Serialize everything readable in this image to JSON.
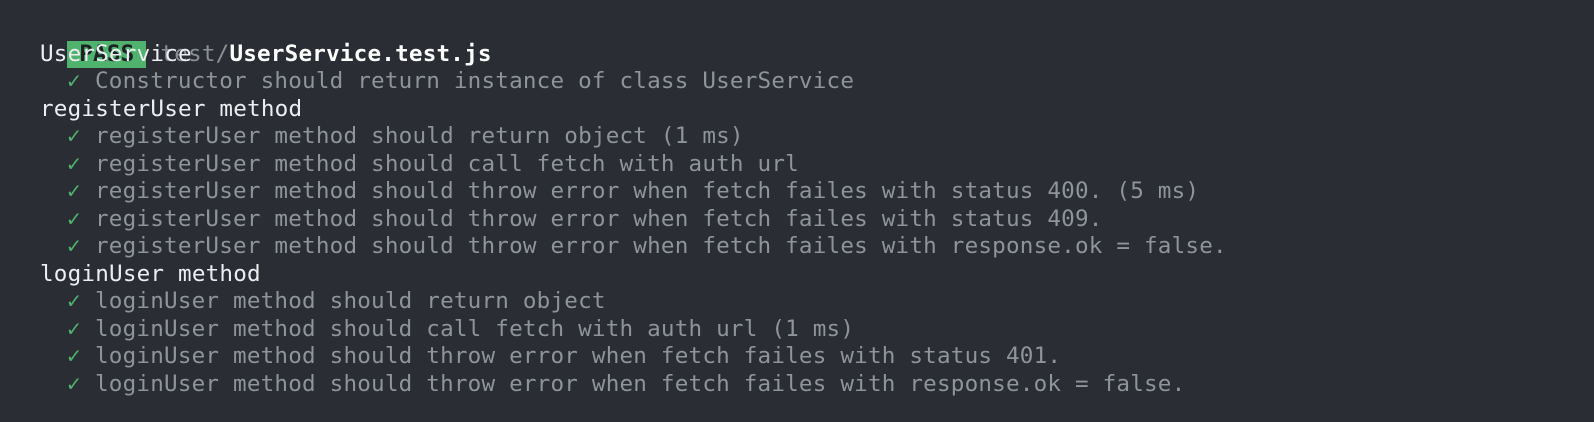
{
  "header": {
    "status_badge": "PASS",
    "path_dir": "test/",
    "path_file": "UserService.test.js"
  },
  "suites": [
    {
      "title": "UserService",
      "tests": [
        "Constructor should return instance of class UserService"
      ]
    },
    {
      "title": "registerUser method",
      "tests": [
        "registerUser method should return object (1 ms)",
        "registerUser method should call fetch with auth url",
        "registerUser method should throw error when fetch failes with status 400. (5 ms)",
        "registerUser method should throw error when fetch failes with status 409.",
        "registerUser method should throw error when fetch failes with response.ok = false."
      ]
    },
    {
      "title": "loginUser method",
      "tests": [
        "loginUser method should return object",
        "loginUser method should call fetch with auth url (1 ms)",
        "loginUser method should throw error when fetch failes with status 401.",
        "loginUser method should throw error when fetch failes with response.ok = false."
      ]
    }
  ],
  "check_glyph": "✓",
  "colors": {
    "background": "#2a2d33",
    "pass": "#4fb36e",
    "suite_text": "#eceef1",
    "test_text": "#8f939a"
  }
}
